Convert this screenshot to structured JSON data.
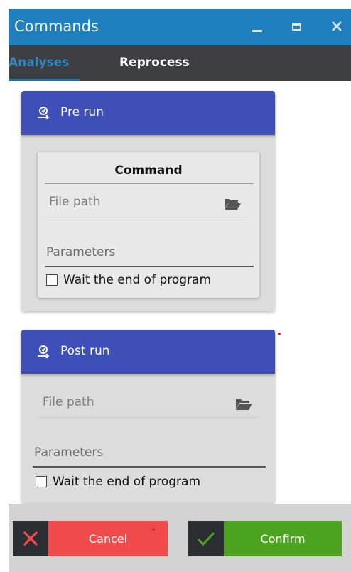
{
  "window": {
    "title": "Commands"
  },
  "tabs": [
    {
      "label": "Analyses",
      "active": true
    },
    {
      "label": "Reprocess",
      "active": false
    }
  ],
  "pre_run": {
    "header": "Pre run",
    "command_title": "Command",
    "file_path_placeholder": "File path",
    "parameters_label": "Parameters",
    "wait_label": "Wait the end of program",
    "wait_checked": false
  },
  "post_run": {
    "header": "Post run",
    "file_path_placeholder": "File path",
    "parameters_label": "Parameters",
    "wait_label": "Wait the end of program",
    "wait_checked": false
  },
  "footer": {
    "cancel_label": "Cancel",
    "confirm_label": "Confirm"
  },
  "colors": {
    "titlebar": "#1f7fbf",
    "tabbar": "#3e3f42",
    "tab_active": "#2f87c1",
    "card_header": "#3f4fb8",
    "cancel": "#f04a4a",
    "confirm": "#4ca31f"
  }
}
